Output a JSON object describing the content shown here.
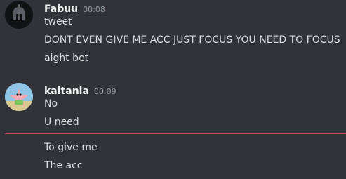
{
  "messages": [
    {
      "author": "Fabuu",
      "timestamp": "00:08",
      "avatar_icon": "spartan-helmet-icon",
      "lines": [
        "tweet",
        "DONT EVEN GIVE ME ACC JUST FOCUS YOU NEED TO FOCUS",
        "aight bet"
      ]
    },
    {
      "author": "kaitania",
      "timestamp": "00:09",
      "avatar_icon": "patrick-star-avatar",
      "lines": [
        "No",
        "U need"
      ]
    }
  ],
  "continued_lines": [
    "To give me",
    "The acc"
  ],
  "colors": {
    "background": "#313338",
    "username": "#f2f3f5",
    "message_text": "#dbdee1",
    "timestamp": "#949ba4",
    "new_messages_divider": "#c14b4b"
  }
}
